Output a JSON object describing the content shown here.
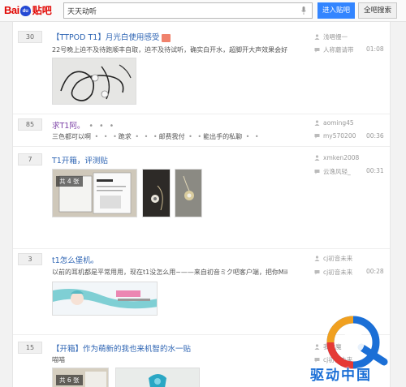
{
  "header": {
    "logo_text": "Bai",
    "logo_paw_text": "du",
    "logo_tieba": "贴吧",
    "search_value": "天天动听",
    "enter_button": "进入贴吧",
    "all_search_button": "全吧搜索"
  },
  "threads": [
    {
      "replies": "30",
      "title": "【TTPOD T1】月光白使用感受",
      "excerpt": "22号晚上迫不及待跑顺丰自取，迫不及待试听，确实白开水，超脚开大声效果会好……",
      "author": "浅唱慢一",
      "last_reply": "人称蘑请带",
      "time": "01:08"
    },
    {
      "replies": "85",
      "title": "求T1阿。",
      "excerpt": "三色都可以啊",
      "excerpt_2": "跪求",
      "excerpt_3": "邮费我付",
      "excerpt_4": "能出手的私聊",
      "author": "aoming45",
      "last_reply": "my570200",
      "time": "00:36"
    },
    {
      "replies": "7",
      "title": "T1开箱，评测贴",
      "image_count": "共 4 张",
      "author": "xmken2008",
      "last_reply": "云逸风轻_",
      "time": "00:31"
    },
    {
      "replies": "3",
      "title": "t1怎么堡机。",
      "excerpt": "以前的耳机都是平常用用，现在t1没怎么用~——来自初音ミク吧客户端，把你Mik…",
      "author": "cj初音未来",
      "last_reply": "cj初音未来",
      "time": "00:28"
    },
    {
      "replies": "15",
      "title": "【开箱】作为萌新的我也来机智的水一贴",
      "excerpt": "喵喵",
      "image_count": "共 6 张",
      "author": "我这魔",
      "last_reply": "cj初音未来",
      "time": ""
    }
  ],
  "watermark": {
    "text": "驱动中国"
  }
}
